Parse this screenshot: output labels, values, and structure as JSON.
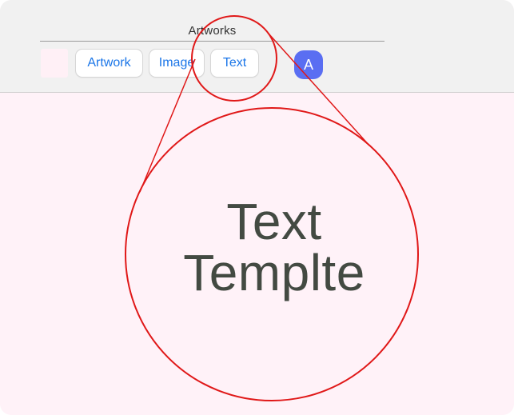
{
  "window": {
    "title": "Artworks"
  },
  "toolbar": {
    "buttons": [
      {
        "label": "Artwork"
      },
      {
        "label": "Image"
      },
      {
        "label": "Text"
      }
    ],
    "avatar_initial": "A"
  },
  "zoom": {
    "line1": "Text",
    "line2": "Templte"
  },
  "colors": {
    "toolbar_bg": "#f1f1f1",
    "canvas_bg": "#fff2f8",
    "accent_blue": "#1b76e8",
    "avatar_bg": "#5a6ef2",
    "zoom_circle": "#e01818",
    "zoom_text": "#434a42"
  }
}
